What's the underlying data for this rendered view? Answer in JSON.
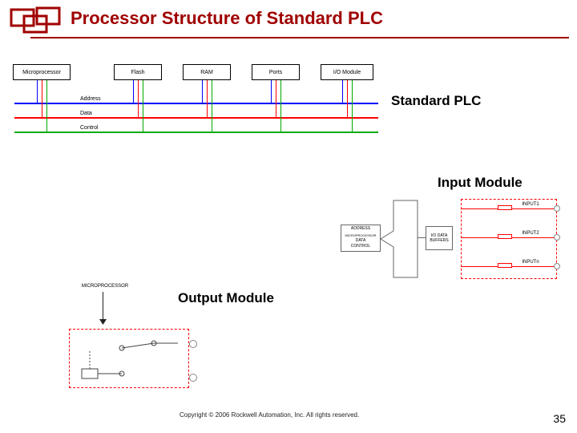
{
  "header": {
    "title": "Processor Structure of Standard PLC"
  },
  "labels": {
    "standard": "Standard PLC",
    "input": "Input Module",
    "output": "Output Module"
  },
  "diagram1": {
    "blocks": [
      "Microprocessor",
      "Flash",
      "RAM",
      "Ports",
      "I/O Module"
    ],
    "buses": [
      "Address",
      "Data",
      "Control"
    ]
  },
  "diagram2": {
    "proc_top": "ADDRESS",
    "proc_mid": "DATA",
    "proc_bot": "CONTROL",
    "proc_box": "MICROPROCESSOR",
    "mid_top": "I/O DATA",
    "mid_bot": "BUFFERS",
    "inputs": [
      "INPUT1",
      "INPUT2",
      "INPUTn"
    ]
  },
  "diagram3": {
    "proc": "MICROPROCESSOR"
  },
  "footer": {
    "copyright": "Copyright © 2006 Rockwell Automation, Inc. All rights reserved.",
    "page": "35"
  }
}
